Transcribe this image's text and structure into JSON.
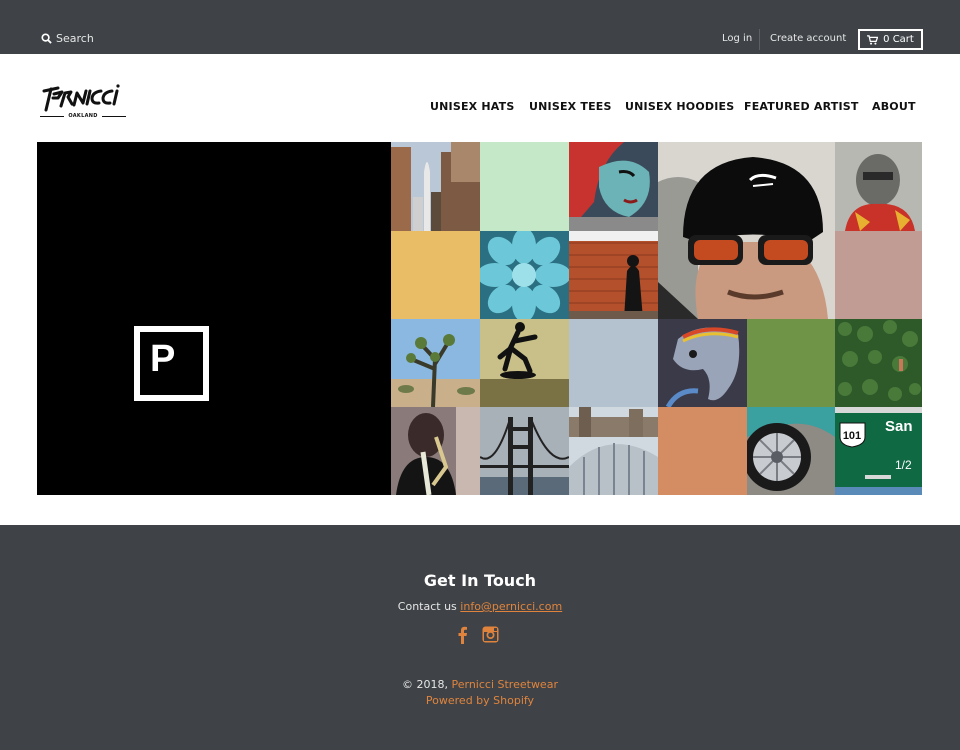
{
  "topbar": {
    "search_label": "Search",
    "login_label": "Log in",
    "create_account_label": "Create account",
    "cart_label": "0 Cart"
  },
  "logo": {
    "text": "Pernicci",
    "sub": "OAKLAND"
  },
  "nav": {
    "items": [
      {
        "label": "UNISEX HATS"
      },
      {
        "label": "UNISEX TEES"
      },
      {
        "label": "UNISEX HOODIES"
      },
      {
        "label": "FEATURED ARTIST"
      },
      {
        "label": "ABOUT"
      }
    ]
  },
  "hero": {
    "logo_letter": "P",
    "grid_tiles": [
      {
        "name": "rocket-city-photo"
      },
      {
        "name": "mint-color-tile",
        "color": "#c4e8c8"
      },
      {
        "name": "mural-woman-photo"
      },
      {
        "name": "hat-man-photo"
      },
      {
        "name": "old-man-mural-photo"
      },
      {
        "name": "mustard-color-tile",
        "color": "#e8bd66"
      },
      {
        "name": "succulent-photo"
      },
      {
        "name": "brick-wall-photo"
      },
      {
        "name": "rose-color-tile",
        "color": "#c09c94"
      },
      {
        "name": "joshua-tree-photo"
      },
      {
        "name": "skateboarder-photo"
      },
      {
        "name": "slate-color-tile",
        "color": "#b4c2d0"
      },
      {
        "name": "elephant-mural-photo"
      },
      {
        "name": "olive-color-tile",
        "color": "#6f9448"
      },
      {
        "name": "vine-wall-photo"
      },
      {
        "name": "saxophone-mural-photo"
      },
      {
        "name": "golden-gate-photo"
      },
      {
        "name": "kauffman-center-photo"
      },
      {
        "name": "terracotta-color-tile",
        "color": "#d48d62"
      },
      {
        "name": "car-wheel-photo"
      },
      {
        "name": "highway-sign-photo",
        "sign_number": "101",
        "sign_text": "San",
        "sign_fraction": "1/2"
      }
    ]
  },
  "footer": {
    "heading": "Get In Touch",
    "contact_prefix": "Contact us ",
    "contact_email": "info@pernicci.com",
    "social": [
      {
        "icon": "facebook-icon"
      },
      {
        "icon": "instagram-icon"
      }
    ],
    "copyright_prefix": "© 2018, ",
    "copyright_brand": "Pernicci Streetwear",
    "powered_by": "Powered by Shopify"
  },
  "colors": {
    "topbar_bg": "#3f4347",
    "accent": "#e0843d",
    "hero_bg": "#000000"
  }
}
